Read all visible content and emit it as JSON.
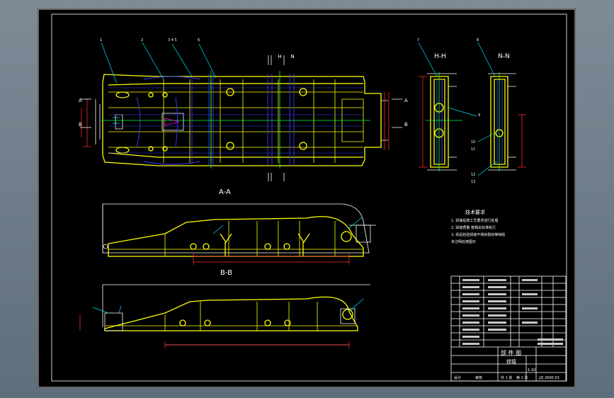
{
  "labels": {
    "top_section_h": "H",
    "top_section_n": "N",
    "section_a": "A",
    "section_b": "B",
    "view_aa": "A-A",
    "view_bb": "B-B",
    "view_hh": "H-H",
    "view_nn": "N-N",
    "callouts": [
      "1",
      "2",
      "3 4 5",
      "6",
      "7",
      "8",
      "9",
      "10",
      "11",
      "12",
      "13"
    ]
  },
  "tech_notes": {
    "heading": "技术要求",
    "lines": [
      "1. 焊接后按工艺要求进行处理",
      "2. 焊缝质量  按相关标准执行",
      "3. 焊后检验焊缝不得有裂纹等缺陷",
      "未注明处按图示"
    ]
  },
  "title_block": {
    "part_type": "部 件 图",
    "drawing_name": "焊接",
    "drawing_number": "JZJ 2000 03",
    "scale": "1:10",
    "designer": "设计",
    "checker": "审核",
    "sheet_total": "共 1 张",
    "sheet_no": "第 1 张"
  },
  "parts_list_rows": 13,
  "colors": {
    "frame": "#ffffff",
    "outline": "#ffff00",
    "hidden": "#3c3cff",
    "dimension": "#ff2a2a",
    "center": "#00ff40"
  }
}
